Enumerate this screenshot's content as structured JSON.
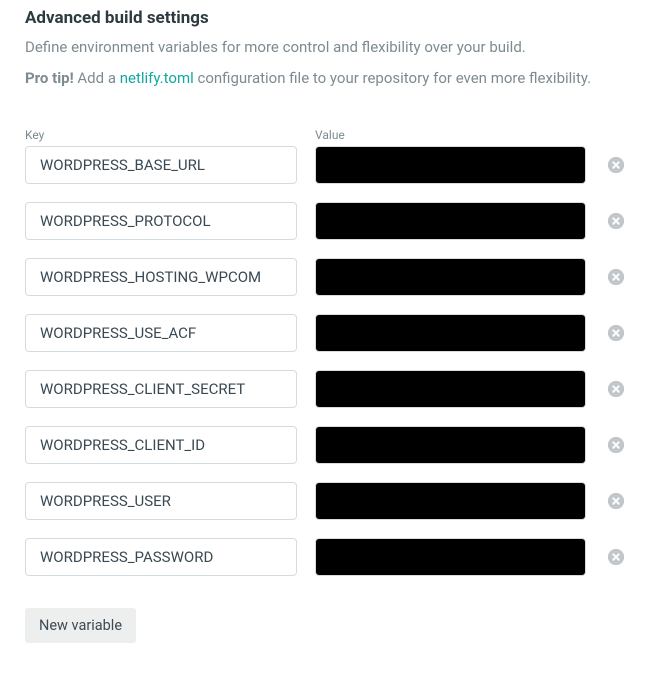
{
  "heading": "Advanced build settings",
  "description": "Define environment variables for more control and flexibility over your build.",
  "protip": {
    "prefix": "Pro tip!",
    "before_link": " Add a ",
    "link_text": "netlify.toml",
    "after_link": " configuration file to your repository for even more flexibility."
  },
  "labels": {
    "key": "Key",
    "value": "Value"
  },
  "variables": [
    {
      "key": "WORDPRESS_BASE_URL",
      "value": "████████████████"
    },
    {
      "key": "WORDPRESS_PROTOCOL",
      "value": "████████████████"
    },
    {
      "key": "WORDPRESS_HOSTING_WPCOM",
      "value": "████████████████"
    },
    {
      "key": "WORDPRESS_USE_ACF",
      "value": "████████████████"
    },
    {
      "key": "WORDPRESS_CLIENT_SECRET",
      "value": "████████████████"
    },
    {
      "key": "WORDPRESS_CLIENT_ID",
      "value": "████████████████"
    },
    {
      "key": "WORDPRESS_USER",
      "value": "████████████████"
    },
    {
      "key": "WORDPRESS_PASSWORD",
      "value": "████████████████"
    }
  ],
  "new_variable_label": "New variable"
}
